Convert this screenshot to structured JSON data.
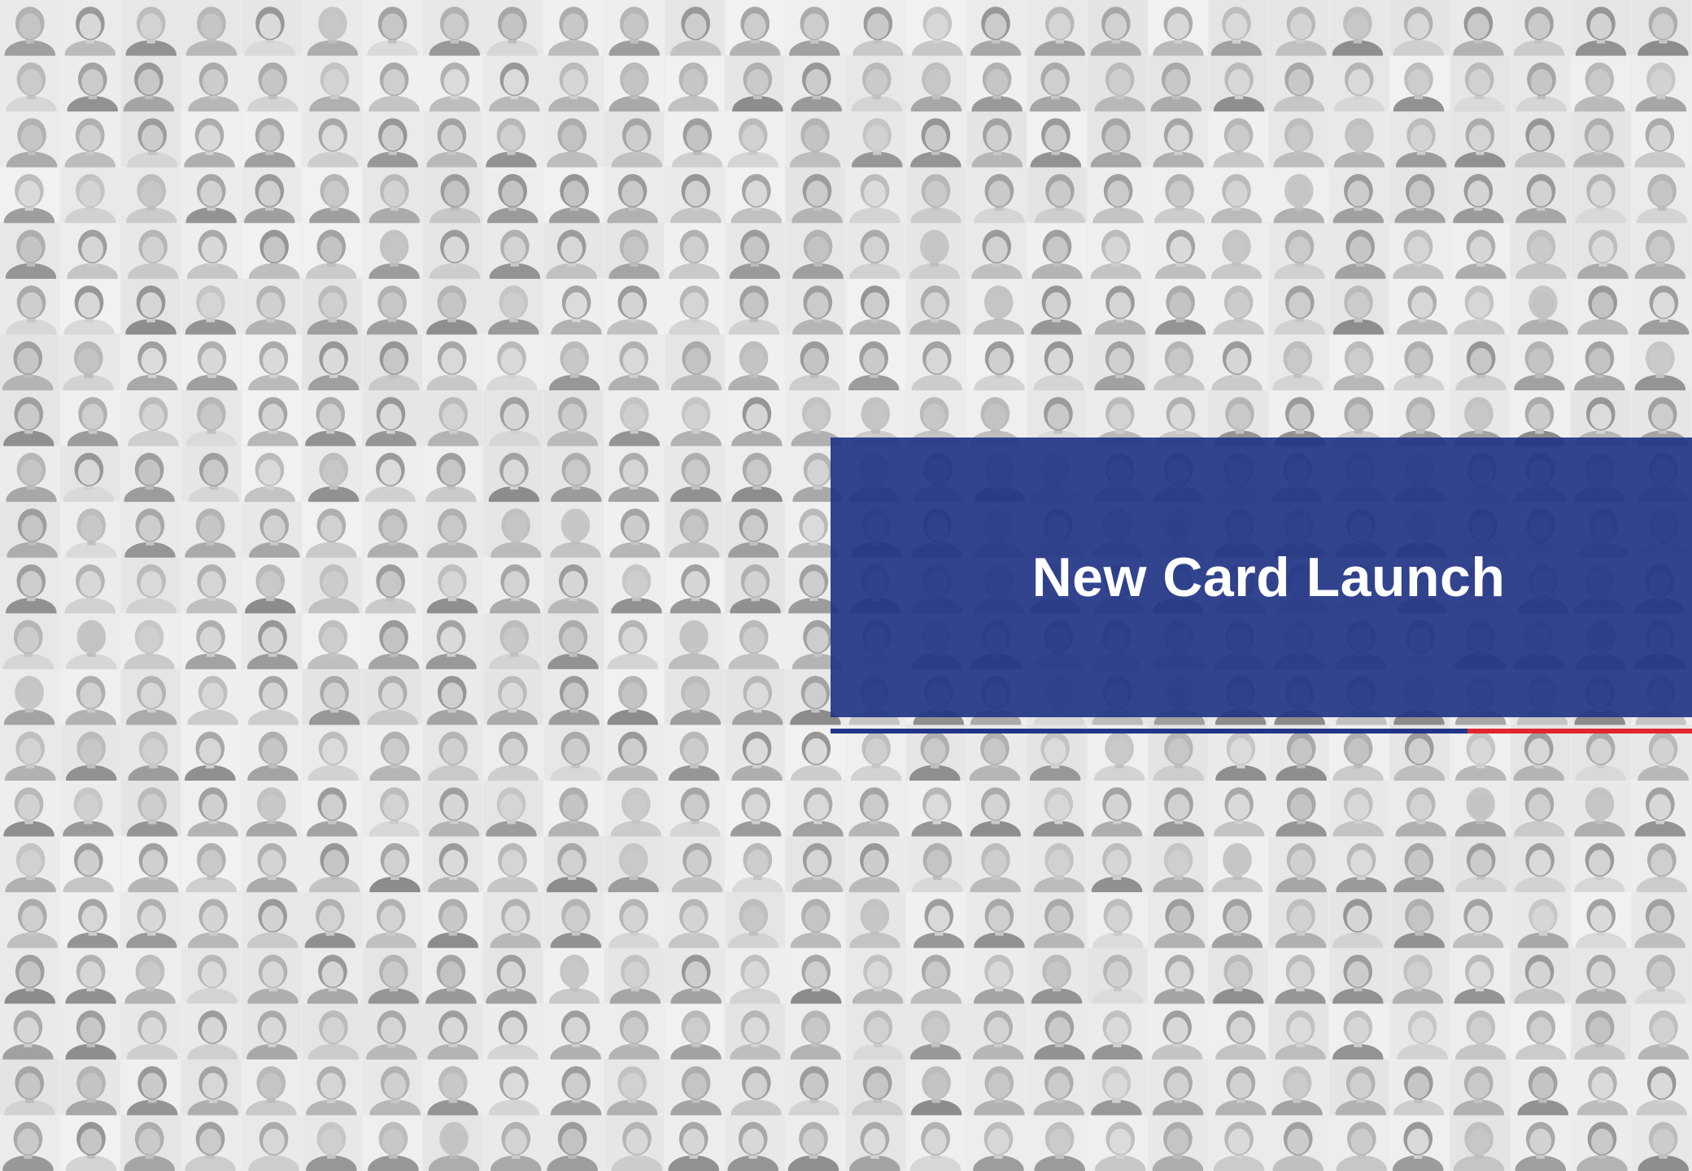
{
  "slide": {
    "title": "New Card Launch"
  },
  "background": {
    "description_icon": "portrait-mosaic",
    "tint": "#e8e8e8"
  },
  "colors": {
    "title_box": "#233587",
    "accent_blue": "#233587",
    "accent_red": "#e0262e",
    "text": "#ffffff"
  }
}
